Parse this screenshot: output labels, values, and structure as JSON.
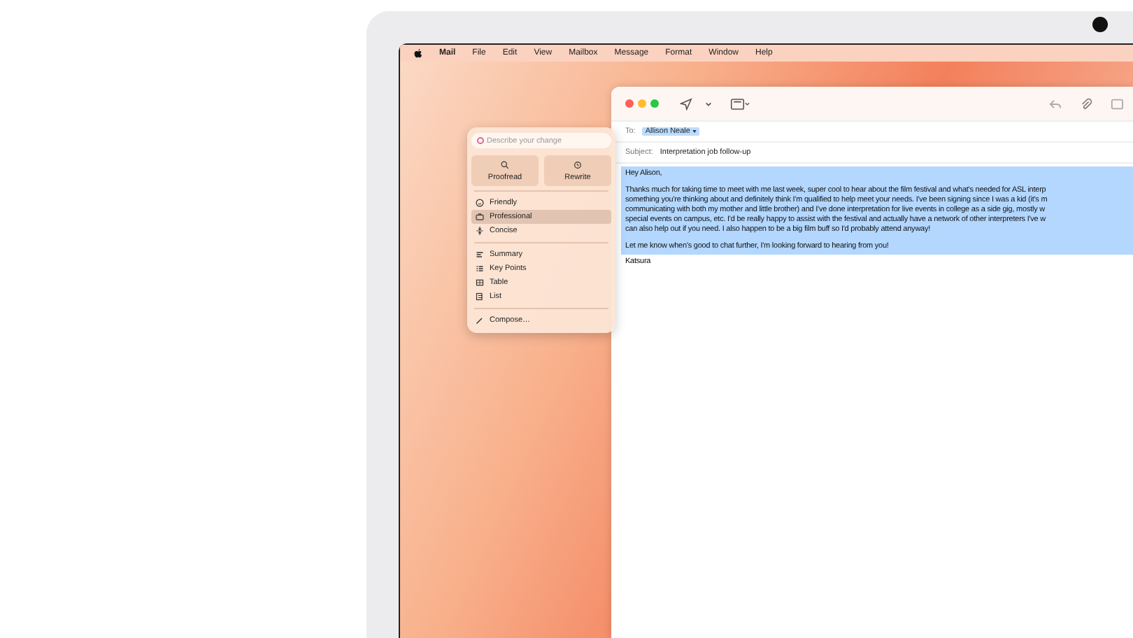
{
  "menu_bar": {
    "app_name": "Mail",
    "menus": [
      "File",
      "Edit",
      "View",
      "Mailbox",
      "Message",
      "Format",
      "Window",
      "Help"
    ]
  },
  "writing_tools": {
    "placeholder": "Describe your change",
    "actions": [
      {
        "kind": "proofread",
        "label": "Proofread"
      },
      {
        "kind": "rewrite",
        "label": "Rewrite"
      }
    ],
    "tones": [
      {
        "kind": "friendly",
        "label": "Friendly",
        "selected": false
      },
      {
        "kind": "professional",
        "label": "Professional",
        "selected": true
      },
      {
        "kind": "concise",
        "label": "Concise",
        "selected": false
      }
    ],
    "formats": [
      {
        "kind": "summary",
        "label": "Summary"
      },
      {
        "kind": "keypoints",
        "label": "Key Points"
      },
      {
        "kind": "table",
        "label": "Table"
      },
      {
        "kind": "list",
        "label": "List"
      }
    ],
    "compose": "Compose…"
  },
  "mail": {
    "to_label": "To:",
    "recipient": "Allison Neale",
    "subject_label": "Subject:",
    "subject": "Interpretation job follow-up",
    "selected": true,
    "greeting": "Hey Alison,",
    "paragraph_lines": [
      "Thanks much for taking time to meet with me last week, super cool to hear about the film festival and what's needed for ASL interp",
      "something you're thinking about and definitely think I'm qualified to help meet your needs. I've been signing since I was a kid (it's m",
      "communicating with both my mother and little brother) and I've done interpretation for  live events in college as a side gig, mostly w",
      "special events on campus, etc. I'd be really happy to assist with the festival and actually have a network of other interpreters I've w",
      "can also help out if you need. I also happen to be a big film buff so I'd probably attend anyway!"
    ],
    "closing": "Let me know when's good to chat further, I'm looking forward to hearing from you!",
    "signature": "Katsura"
  }
}
